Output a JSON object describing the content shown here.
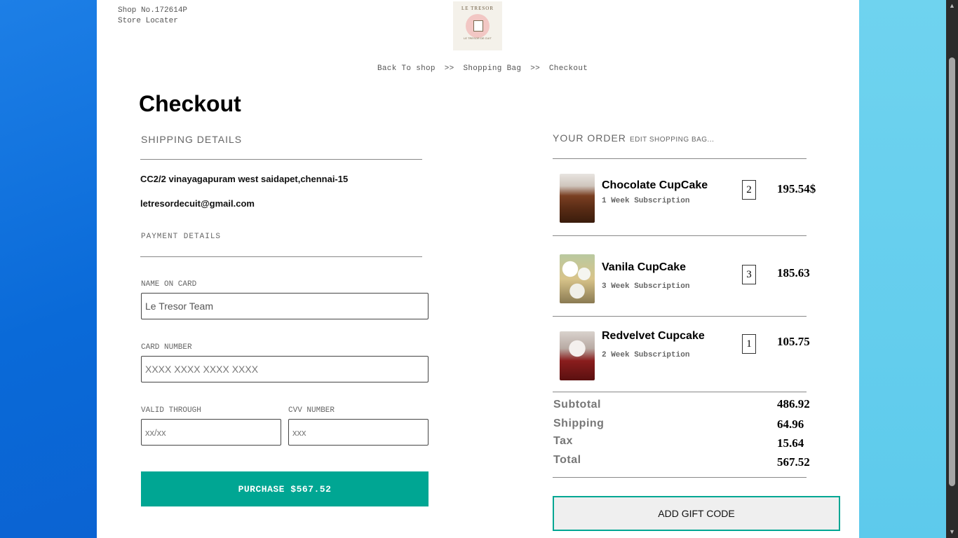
{
  "header": {
    "shop_no": "Shop No.172614P",
    "store_locator": "Store Locater",
    "logo_text": "LE TRESOR",
    "logo_tagline": "LE TRESOR DE CUIT"
  },
  "breadcrumb": {
    "back": "Back To shop",
    "sep1": ">>",
    "bag": "Shopping Bag",
    "sep2": ">>",
    "current": "Checkout"
  },
  "page_title": "Checkout",
  "shipping": {
    "heading": "SHIPPING DETAILS",
    "address": "CC2/2 vinayagapuram west saidapet,chennai-15",
    "email": "letresordecuit@gmail.com"
  },
  "payment": {
    "heading": "PAYMENT DETAILS",
    "name_label": "NAME ON CARD",
    "name_value": "Le Tresor Team",
    "card_label": "CARD NUMBER",
    "card_placeholder": "XXXX XXXX XXXX XXXX",
    "valid_label": "VALID THROUGH",
    "valid_placeholder": "xx/xx",
    "cvv_label": "CVV NUMBER",
    "cvv_placeholder": "xxx",
    "purchase_label": "PURCHASE  $567.52"
  },
  "order": {
    "heading": "YOUR ORDER",
    "edit_link": "EDIT SHOPPING BAG...",
    "items": [
      {
        "name": "Chocolate CupCake",
        "subscription": "1 Week Subscription",
        "qty": "2",
        "price": "195.54$"
      },
      {
        "name": "Vanila CupCake",
        "subscription": "3 Week Subscription",
        "qty": "3",
        "price": "185.63"
      },
      {
        "name": "Redvelvet Cupcake",
        "subscription": "2 Week Subscription",
        "qty": "1",
        "price": "105.75"
      }
    ],
    "summary": {
      "subtotal_label": "Subtotal",
      "subtotal": "486.92",
      "shipping_label": "Shipping",
      "shipping": "64.96",
      "tax_label": "Tax",
      "tax": "15.64",
      "total_label": "Total",
      "total": "567.52"
    },
    "gift_code_label": "ADD GIFT CODE"
  },
  "colors": {
    "accent": "#00a693",
    "left_bg": "#0b6bd8",
    "right_bg": "#66cfee"
  }
}
